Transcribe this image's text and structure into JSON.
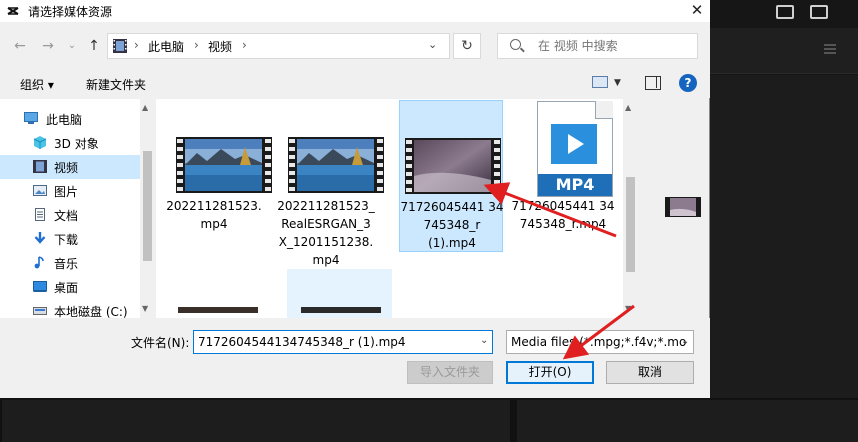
{
  "dialog": {
    "title": "请选择媒体资源",
    "close": "✕"
  },
  "nav": {
    "back": "←",
    "forward": "→",
    "recent": "⌄",
    "up": "↑",
    "path": [
      "此电脑",
      "视频"
    ],
    "separator": "›",
    "refresh": "↻",
    "search_placeholder": "在 视频 中搜索"
  },
  "toolbar": {
    "organize": "组织 ▾",
    "new_folder": "新建文件夹",
    "help": "?"
  },
  "sidebar": {
    "items": [
      {
        "label": "此电脑",
        "icon": "computer-icon"
      },
      {
        "label": "3D 对象",
        "icon": "cube-icon"
      },
      {
        "label": "视频",
        "icon": "film-icon",
        "selected": true
      },
      {
        "label": "图片",
        "icon": "picture-icon"
      },
      {
        "label": "文档",
        "icon": "document-icon"
      },
      {
        "label": "下载",
        "icon": "download-icon"
      },
      {
        "label": "音乐",
        "icon": "music-icon"
      },
      {
        "label": "桌面",
        "icon": "desktop-icon"
      },
      {
        "label": "本地磁盘 (C:)",
        "icon": "disk-icon"
      }
    ]
  },
  "files": [
    {
      "name": "202211281523.\nmp4",
      "thumb": "lake"
    },
    {
      "name": "202211281523_\nRealESRGAN_3\nX_1201151238.\nmp4",
      "thumb": "lake"
    },
    {
      "name": "71726045441 34\n745348_r\n(1).mp4",
      "thumb": "purple",
      "selected": true
    },
    {
      "name": "71726045441 34\n745348_r.mp4",
      "thumb": "mp4-doc",
      "badge": "MP4"
    }
  ],
  "footer": {
    "filename_label": "文件名(N):",
    "filename_value": "7172604544134745348_r (1).mp4",
    "filetype_value": "Media files (*.mpg;*.f4v;*.mo",
    "import_folder": "导入文件夹",
    "open": "打开(O)",
    "cancel": "取消"
  },
  "colors": {
    "selection": "#cce8ff",
    "accent": "#0078d7",
    "arrow": "#e02020"
  }
}
